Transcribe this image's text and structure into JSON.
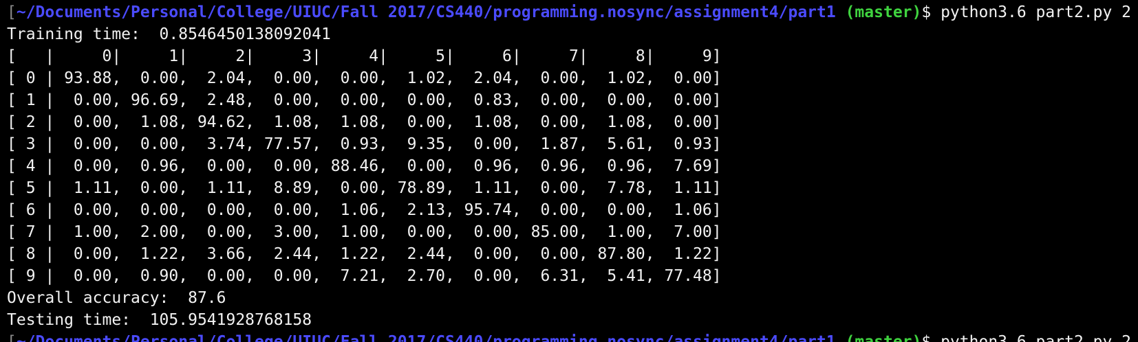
{
  "prompt": {
    "bracket": "[",
    "path": "~/Documents/Personal/College/UIUC/Fall 2017/CS440/programming.nosync/assignment4/part1",
    "branch": "(master)",
    "dollar": "$",
    "command": "python3.6 part2.py 2"
  },
  "output": {
    "training_time": "Training time:  0.8546450138092041",
    "header_row": "[   |     0|     1|     2|     3|     4|     5|     6|     7|     8|     9]",
    "matrix_rows": [
      "[ 0 | 93.88,  0.00,  2.04,  0.00,  0.00,  1.02,  2.04,  0.00,  1.02,  0.00]",
      "[ 1 |  0.00, 96.69,  2.48,  0.00,  0.00,  0.00,  0.83,  0.00,  0.00,  0.00]",
      "[ 2 |  0.00,  1.08, 94.62,  1.08,  1.08,  0.00,  1.08,  0.00,  1.08,  0.00]",
      "[ 3 |  0.00,  0.00,  3.74, 77.57,  0.93,  9.35,  0.00,  1.87,  5.61,  0.93]",
      "[ 4 |  0.00,  0.96,  0.00,  0.00, 88.46,  0.00,  0.96,  0.96,  0.96,  7.69]",
      "[ 5 |  1.11,  0.00,  1.11,  8.89,  0.00, 78.89,  1.11,  0.00,  7.78,  1.11]",
      "[ 6 |  0.00,  0.00,  0.00,  0.00,  1.06,  2.13, 95.74,  0.00,  0.00,  1.06]",
      "[ 7 |  1.00,  2.00,  0.00,  3.00,  1.00,  0.00,  0.00, 85.00,  1.00,  7.00]",
      "[ 8 |  0.00,  1.22,  3.66,  2.44,  1.22,  2.44,  0.00,  0.00, 87.80,  1.22]",
      "[ 9 |  0.00,  0.90,  0.00,  0.00,  7.21,  2.70,  0.00,  6.31,  5.41, 77.48]"
    ],
    "overall_accuracy": "Overall accuracy:  87.6",
    "testing_time": "Testing time:  105.9541928768158"
  },
  "colors": {
    "background": "#000000",
    "text": "#f2f2f2",
    "path": "#4b4bff",
    "branch": "#3fd33f"
  }
}
